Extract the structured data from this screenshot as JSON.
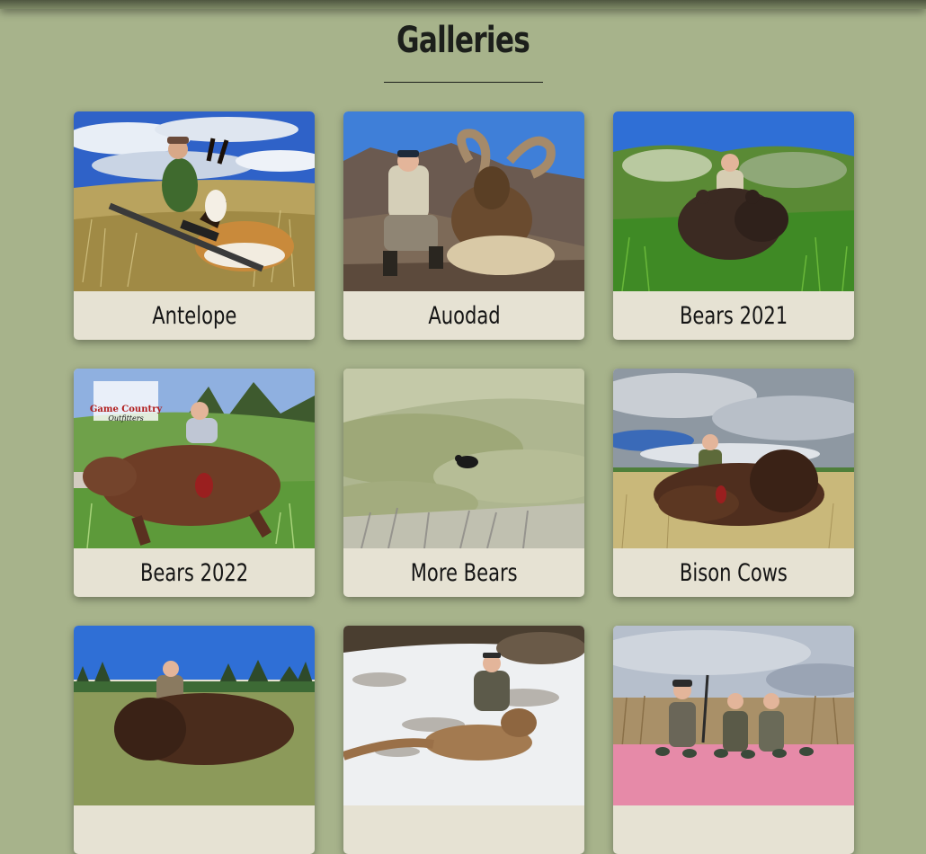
{
  "page": {
    "title": "Galleries"
  },
  "galleries": [
    {
      "label": "Antelope",
      "photo": "antelope-hunter-photo"
    },
    {
      "label": "Auodad",
      "photo": "aoudad-hunter-photo"
    },
    {
      "label": "Bears 2021",
      "photo": "bear-hunter-photo"
    },
    {
      "label": "Bears 2022",
      "photo": "grizzly-hunter-photo"
    },
    {
      "label": "More Bears",
      "photo": "distant-bear-photo"
    },
    {
      "label": "Bison Cows",
      "photo": "bison-cow-hunter-photo"
    },
    {
      "label": "",
      "photo": "bison-hunter-photo"
    },
    {
      "label": "",
      "photo": "mountain-lion-hunter-photo"
    },
    {
      "label": "",
      "photo": "duck-hunters-photo"
    }
  ],
  "colors": {
    "background": "#a7b38b",
    "card": "#e6e2d3",
    "text": "#141414"
  }
}
